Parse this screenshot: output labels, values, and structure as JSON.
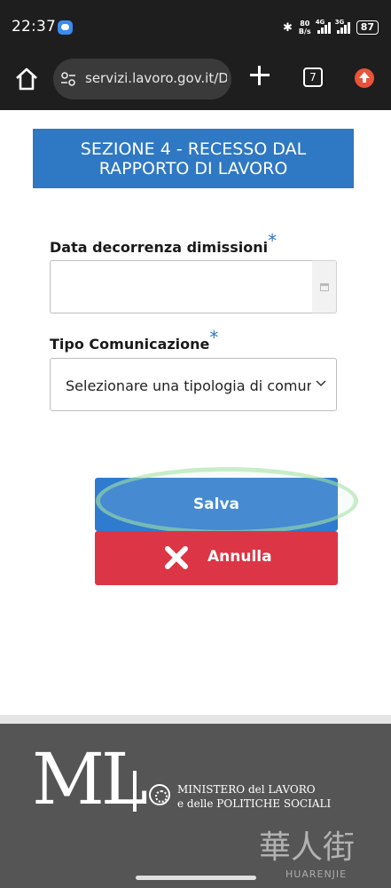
{
  "status_bar": {
    "time": "22:37",
    "speed_top": "80",
    "speed_bottom": "B/s",
    "signal1_label": "4G",
    "signal2_label": "3G",
    "battery": "87"
  },
  "browser": {
    "url": "servizi.lavoro.gov.it/D",
    "tab_count": "7"
  },
  "form": {
    "section_title_line1": "SEZIONE 4 - RECESSO DAL",
    "section_title_line2": "RAPPORTO DI LAVORO",
    "date_label": "Data decorrenza dimissioni",
    "date_value": "",
    "type_label": "Tipo Comunicazione",
    "type_value": "Selezionare una tipologia di comunicazione",
    "required_marker": "*"
  },
  "actions": {
    "save_label": "Salva",
    "cancel_label": "Annulla"
  },
  "footer": {
    "logo_text": "ML",
    "ministry_line1": "MINISTERO del LAVORO",
    "ministry_line2": "e delle POLITICHE SOCIALI",
    "watermark": "華人街",
    "watermark_sub": "HUARENJIE"
  },
  "colors": {
    "section_bg": "#2f78c4",
    "save_bg": "#2f7bd0",
    "cancel_bg": "#dc3545",
    "footer_bg": "#555555"
  }
}
